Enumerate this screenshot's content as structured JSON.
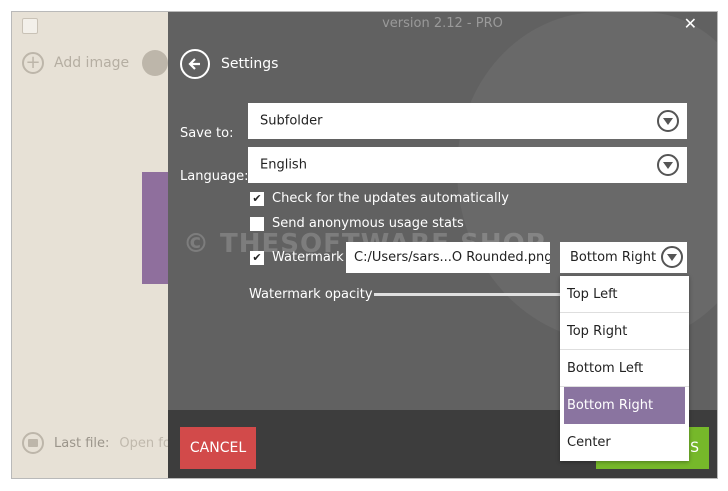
{
  "window": {
    "version": "version 2.12 - PRO"
  },
  "left": {
    "add_image": "Add image",
    "last_file_label": "Last file:",
    "open_folder": "Open fo"
  },
  "settings": {
    "title": "Settings",
    "save_to_label": "Save to:",
    "save_to_value": "Subfolder",
    "language_label": "Language:",
    "language_value": "English",
    "check_updates": "Check for the updates automatically",
    "check_updates_checked": true,
    "anon_stats": "Send anonymous usage stats",
    "anon_stats_checked": false,
    "watermark_label": "Watermark",
    "watermark_checked": true,
    "watermark_file": "C:/Users/sars...O Rounded.png",
    "watermark_position": "Bottom Right",
    "watermark_opacity_label": "Watermark opacity",
    "overlay_text": "© THESOFTWARE SHOP"
  },
  "footer": {
    "cancel": "CANCEL",
    "confirm_partial": "S"
  },
  "dropdown": {
    "options": [
      "Top Left",
      "Top Right",
      "Bottom Left",
      "Bottom Right",
      "Center"
    ],
    "selected_index": 3
  },
  "colors": {
    "panel": "#616161",
    "footer": "#3d3d3d",
    "cancel": "#d24a4a",
    "confirm": "#76b82a",
    "selected": "#8a74a0"
  }
}
